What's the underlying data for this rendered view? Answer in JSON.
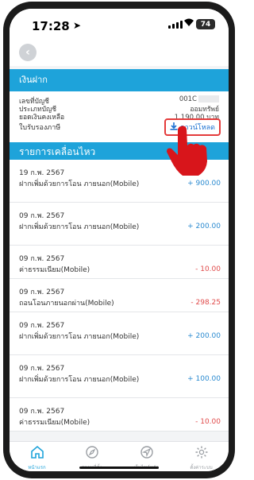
{
  "status_bar": {
    "time": "17:28",
    "battery": "74"
  },
  "deposit_header": "เงินฝาก",
  "account_info": {
    "account_no_label": "เลขที่บัญชี",
    "account_no_value": "001C",
    "account_type_label": "ประเภทบัญชี",
    "account_type_value": "ออมทรัพย์",
    "balance_label": "ยอดเงินคงเหลือ",
    "balance_value": "1,190.00 บาท",
    "tax_cert_label": "ใบรับรองภาษี",
    "download_label": "ดาวน์โหลด"
  },
  "movement_header": "รายการเคลื่อนไหว",
  "transactions": [
    {
      "date": "19 ก.พ. 2567",
      "desc": "ฝากเพิ่มด้วยการโอน ภายนอก(Mobile)",
      "amount": "+ 900.00",
      "type": "pos"
    },
    {
      "date": "09 ก.พ. 2567",
      "desc": "ฝากเพิ่มด้วยการโอน ภายนอก(Mobile)",
      "amount": "+ 200.00",
      "type": "pos"
    },
    {
      "date": "09 ก.พ. 2567",
      "desc": "ค่าธรรมเนียม(Mobile)",
      "amount": "- 10.00",
      "type": "neg"
    },
    {
      "date": "09 ก.พ. 2567",
      "desc": "ถอนโอนภายนอกผ่าน(Mobile)",
      "amount": "- 298.25",
      "type": "neg"
    },
    {
      "date": "09 ก.พ. 2567",
      "desc": "ฝากเพิ่มด้วยการโอน ภายนอก(Mobile)",
      "amount": "+ 200.00",
      "type": "pos"
    },
    {
      "date": "09 ก.พ. 2567",
      "desc": "ฝากเพิ่มด้วยการโอน ภายนอก(Mobile)",
      "amount": "+ 100.00",
      "type": "pos"
    },
    {
      "date": "09 ก.พ. 2567",
      "desc": "ค่าธรรมเนียม(Mobile)",
      "amount": "- 10.00",
      "type": "neg"
    }
  ],
  "bottom_nav": [
    {
      "label": "หน้าแรก",
      "icon": "home-icon",
      "active": true
    },
    {
      "label": "สถานที่ตั้ง",
      "icon": "compass-icon",
      "active": false
    },
    {
      "label": "เว็บไซต์หลัก",
      "icon": "navigation-icon",
      "active": false
    },
    {
      "label": "ตั้งค่าระบบ",
      "icon": "gear-icon",
      "active": false
    }
  ],
  "colors": {
    "accent": "#1ea3da",
    "positive": "#2a8ad0",
    "negative": "#e04a4a",
    "highlight": "#e43b3b"
  }
}
